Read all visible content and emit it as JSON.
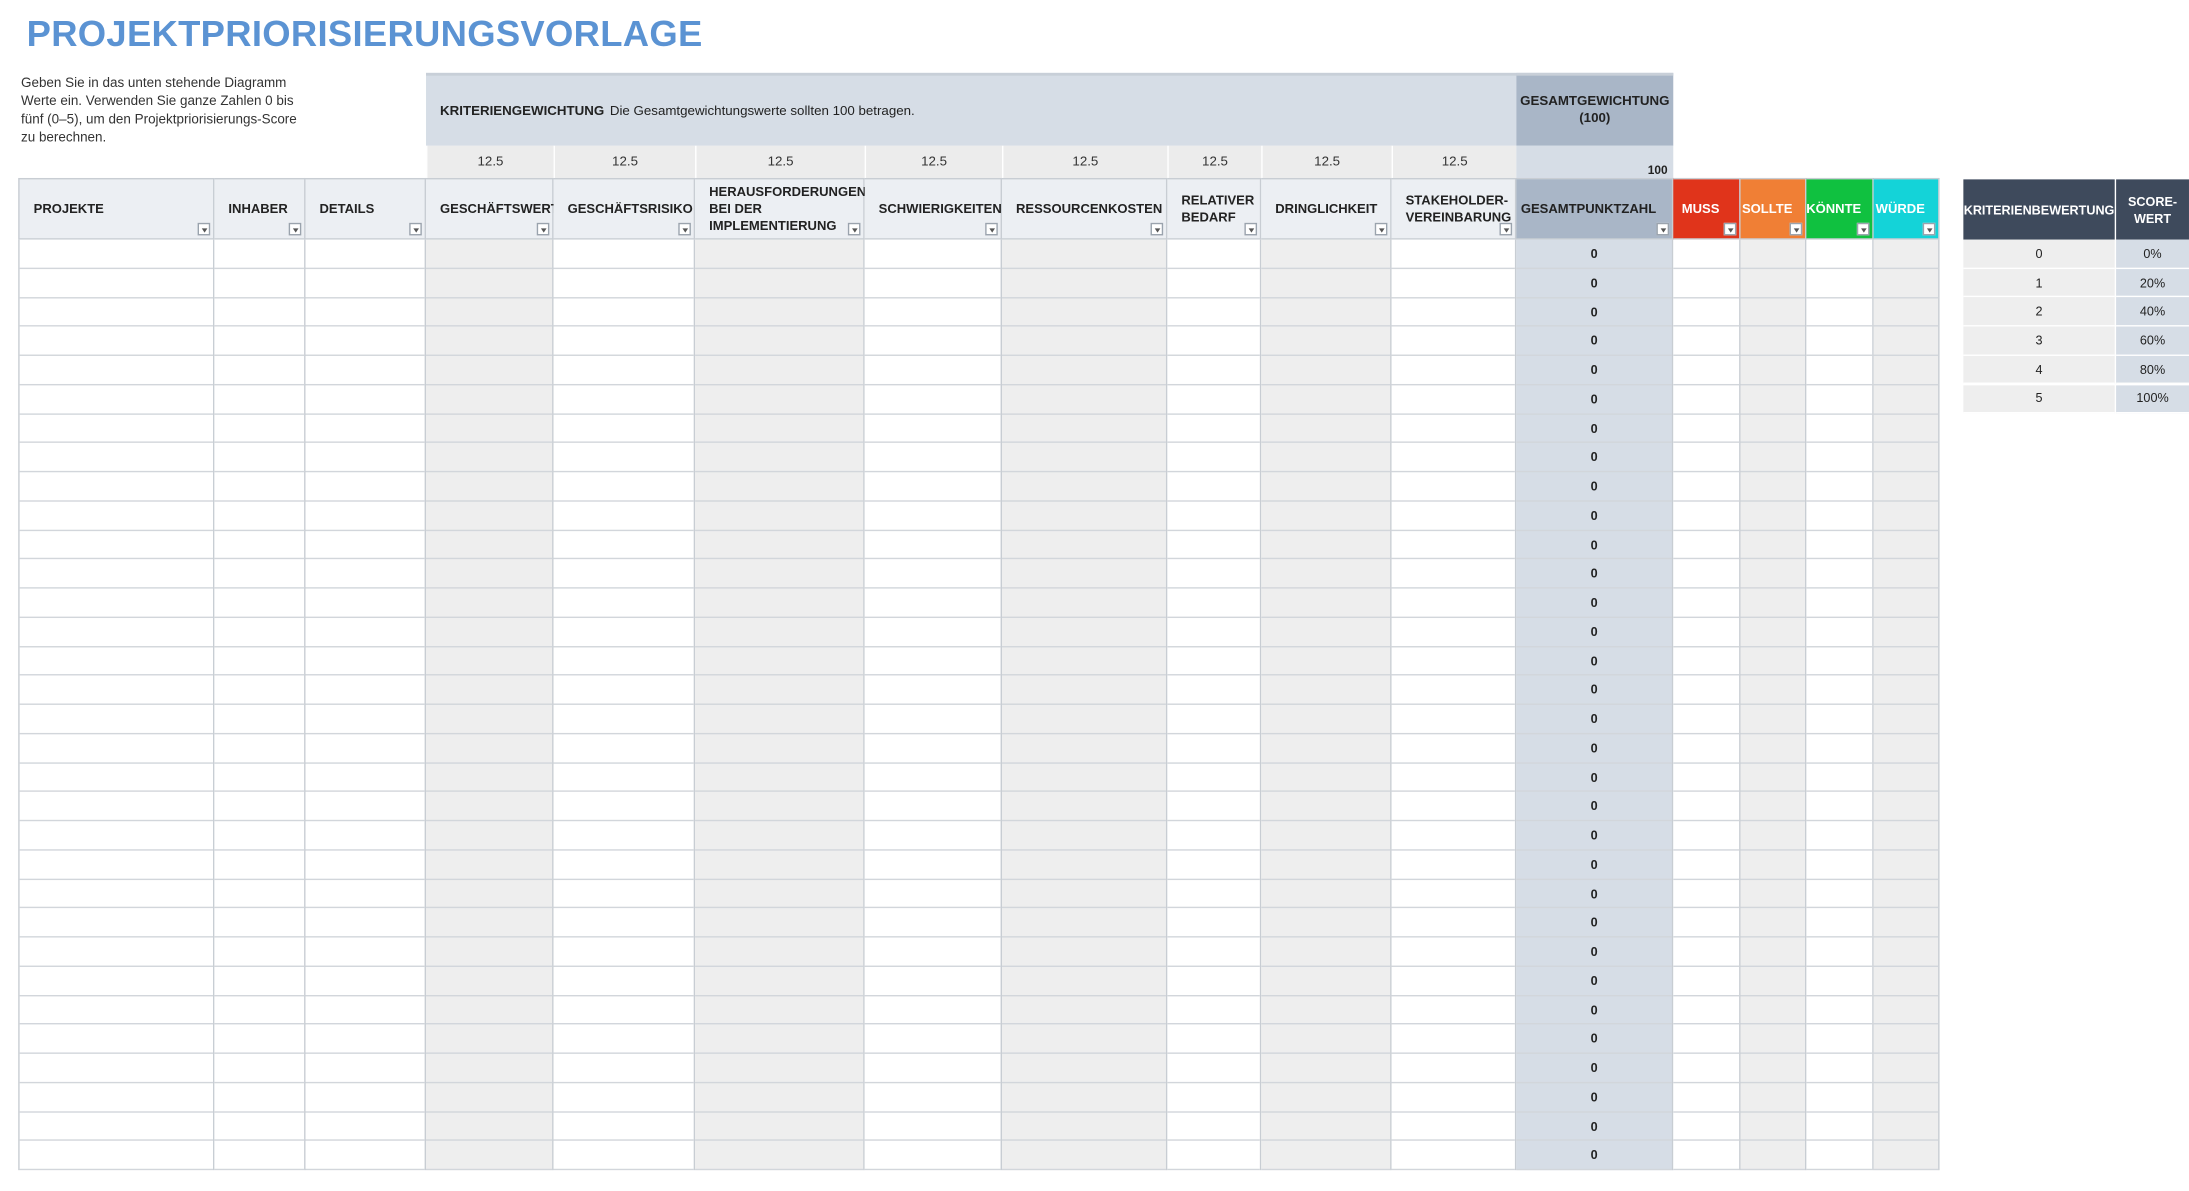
{
  "title": "PROJEKTPRIORISIERUNGSVORLAGE",
  "instructions": "Geben Sie in das unten stehende Diagramm Werte ein. Verwenden Sie ganze Zahlen 0 bis fünf (0–5), um den Projektpriorisierungs-Score zu berechnen.",
  "weighting_box": {
    "label": "KRITERIENGEWICHTUNG",
    "text": "Die Gesamtgewichtungswerte sollten 100 betragen."
  },
  "total_weight_box": {
    "label": "GESAMTGEWICHTUNG (100)",
    "value": "100"
  },
  "weights": [
    "12.5",
    "12.5",
    "12.5",
    "12.5",
    "12.5",
    "12.5",
    "12.5",
    "12.5"
  ],
  "headers": {
    "projekte": "PROJEKTE",
    "inhaber": "INHABER",
    "details": "DETAILS",
    "criteria": [
      "GESCHÄFTSWERT",
      "GESCHÄFTSRISIKO",
      "HERAUSFORDERUNGEN BEI DER IMPLEMENTIERUNG",
      "SCHWIERIGKEITEN",
      "RESSOURCENKOSTEN",
      "RELATIVER BEDARF",
      "DRINGLICHKEIT",
      "STAKEHOLDER-VEREINBARUNG"
    ],
    "total": "GESAMTPUNKTZAHL",
    "prio": [
      "MUSS",
      "SOLLTE",
      "KÖNNTE",
      "WÜRDE"
    ]
  },
  "prio_colors": [
    "#e0341b",
    "#f07f35",
    "#10c140",
    "#14d3d8"
  ],
  "total_scores": [
    "0",
    "0",
    "0",
    "0",
    "0",
    "0",
    "0",
    "0",
    "0",
    "0",
    "0",
    "0",
    "0",
    "0",
    "0",
    "0",
    "0",
    "0",
    "0",
    "0",
    "0",
    "0",
    "0",
    "0",
    "0",
    "0",
    "0",
    "0",
    "0",
    "0",
    "0",
    "0"
  ],
  "legend": {
    "header_criteria": "KRITERIENBEWERTUNG",
    "header_score": "SCORE-WERT",
    "rows": [
      {
        "rating": "0",
        "score": "0%"
      },
      {
        "rating": "1",
        "score": "20%"
      },
      {
        "rating": "2",
        "score": "40%"
      },
      {
        "rating": "3",
        "score": "60%"
      },
      {
        "rating": "4",
        "score": "80%"
      },
      {
        "rating": "5",
        "score": "100%"
      }
    ]
  }
}
